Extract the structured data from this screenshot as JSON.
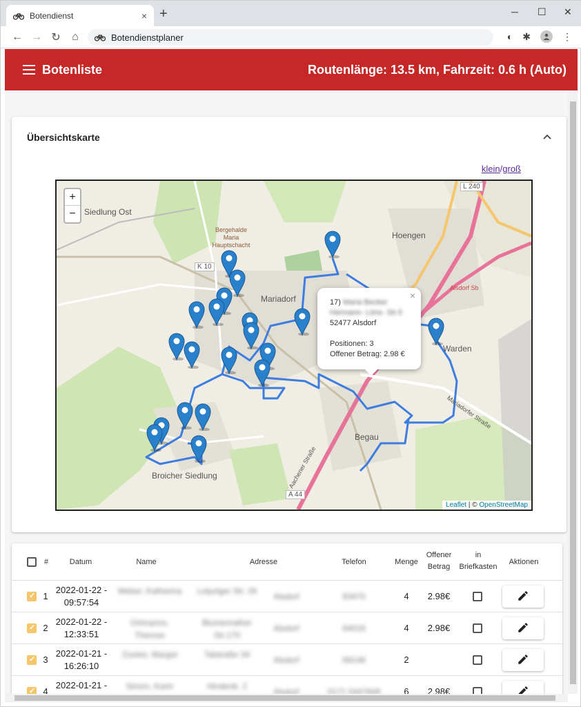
{
  "browser": {
    "tab_title": "Botendienst",
    "address": "Botendienstplaner",
    "tab_close": "×",
    "new_tab": "+",
    "win_min": "─",
    "win_max": "☐",
    "win_close": "✕"
  },
  "header": {
    "title": "Botenliste",
    "route_info": "Routenlänge: 13.5 km, Fahrzeit: 0.6 h (Auto)"
  },
  "map_card": {
    "title": "Übersichtskarte",
    "link_small": "klein",
    "separator": "/",
    "link_large": "groß",
    "zoom_in": "+",
    "zoom_out": "−",
    "attribution_leaflet": "Leaflet",
    "attribution_sep": " | © ",
    "attribution_osm": "OpenStreetMap",
    "labels": {
      "siedlung_ost": "Siedlung Ost",
      "hoengen": "Hoengen",
      "mariadorf": "Mariadorf",
      "warden": "Warden",
      "begau": "Begau",
      "broicher": "Broicher Siedlung",
      "k10": "K 10",
      "l240": "L 240",
      "a44": "A 44",
      "alsdorf_sb": "Alsdorf Sb",
      "bergehalde": "Bergehalde Maria Hauptschacht",
      "mariadorfer_str": "Mariadorfer Straße",
      "aachener_str": "Aachener Straße"
    },
    "popup": {
      "number": "17)",
      "name": "Maria Becker",
      "street": "Hermann- Löns- Str.5",
      "city": "52477 Alsdorf",
      "positions": "Positionen: 3",
      "amount": "Offener Betrag: 2.98 €",
      "close": "×"
    }
  },
  "table": {
    "headers": {
      "num": "#",
      "datum": "Datum",
      "name": "Name",
      "adresse": "Adresse",
      "telefon": "Telefon",
      "menge": "Menge",
      "offen1": "Offener",
      "offen2": "Betrag",
      "brief1": "in",
      "brief2": "Briefkasten",
      "aktionen": "Aktionen"
    },
    "rows": [
      {
        "num": "1",
        "date1": "2022-01-22 -",
        "date2": "09:57:54",
        "name1": "Weber, Katharina",
        "name2": "",
        "street1": "Leipziger Str. 26",
        "street2": "",
        "city": "Alsdorf",
        "phone": "63470",
        "qty": "4",
        "amount": "2.98€"
      },
      {
        "num": "2",
        "date1": "2022-01-22 -",
        "date2": "12:33:51",
        "name1": "Ortmanns,",
        "name2": "Therese",
        "street1": "Blumenrather",
        "street2": "Str.170",
        "city": "Alsdorf",
        "phone": "64016",
        "qty": "4",
        "amount": "2.98€"
      },
      {
        "num": "3",
        "date1": "2022-01-21 -",
        "date2": "16:26:10",
        "name1": "Zucker, Margot",
        "name2": "",
        "street1": "Talstraße 34",
        "street2": "",
        "city": "Alsdorf",
        "phone": "69148",
        "qty": "2",
        "amount": ""
      },
      {
        "num": "4",
        "date1": "2022-01-21 -",
        "date2": "",
        "name1": "Simon, Karin",
        "name2": "",
        "street1": "Hindenb. 2",
        "street2": "",
        "city": "Alsdorf",
        "phone": "0171 5447848",
        "qty": "6",
        "amount": "2.98€"
      }
    ]
  },
  "colors": {
    "header_red": "#c62828",
    "route_blue": "#3d7de0",
    "marker_blue": "#2a81cb",
    "checkbox_orange": "#f6c66a"
  }
}
